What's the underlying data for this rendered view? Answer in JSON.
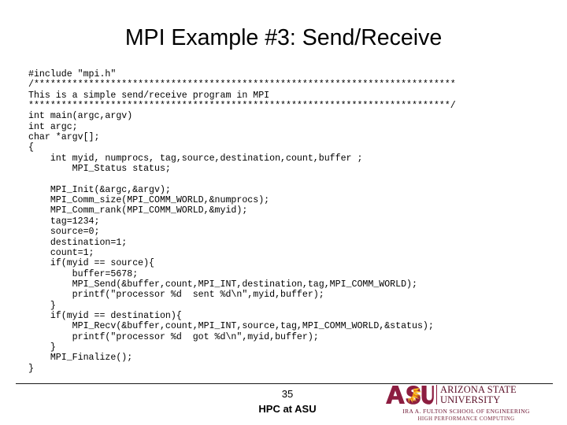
{
  "slide": {
    "title": "MPI Example #3: Send/Receive",
    "background_color": "#ffffff",
    "text_color": "#000000"
  },
  "code": {
    "language": "c",
    "lines": [
      "#include \"mpi.h\"",
      "/*****************************************************************************",
      "This is a simple send/receive program in MPI",
      "*****************************************************************************/",
      "int main(argc,argv)",
      "int argc;",
      "char *argv[];",
      "{",
      "    int myid, numprocs, tag,source,destination,count,buffer ;",
      "        MPI_Status status;",
      "",
      "    MPI_Init(&argc,&argv);",
      "    MPI_Comm_size(MPI_COMM_WORLD,&numprocs);",
      "    MPI_Comm_rank(MPI_COMM_WORLD,&myid);",
      "    tag=1234;",
      "    source=0;",
      "    destination=1;",
      "    count=1;",
      "    if(myid == source){",
      "        buffer=5678;",
      "        MPI_Send(&buffer,count,MPI_INT,destination,tag,MPI_COMM_WORLD);",
      "        printf(\"processor %d  sent %d\\n\",myid,buffer);",
      "    }",
      "    if(myid == destination){",
      "        MPI_Recv(&buffer,count,MPI_INT,source,tag,MPI_COMM_WORLD,&status);",
      "        printf(\"processor %d  got %d\\n\",myid,buffer);",
      "    }",
      "    MPI_Finalize();",
      "}"
    ]
  },
  "footer": {
    "page_number": "35",
    "label": "HPC at ASU",
    "logo": {
      "mark_text": "ASU",
      "university_line1": "ARIZONA STATE",
      "university_line2": "UNIVERSITY",
      "school": "IRA A. FULTON SCHOOL OF ENGINEERING",
      "program": "HIGH PERFORMANCE COMPUTING",
      "maroon": "#8c1d40",
      "gold": "#ffc627"
    }
  }
}
